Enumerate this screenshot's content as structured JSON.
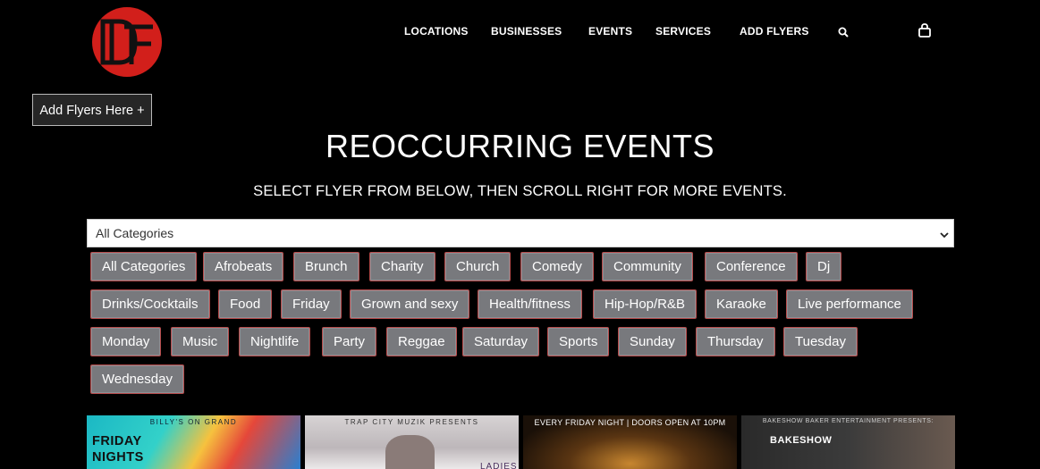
{
  "logo": {
    "text": "DF"
  },
  "nav": {
    "items": [
      {
        "label": "LOCATIONS"
      },
      {
        "label": "BUSINESSES"
      },
      {
        "label": "EVENTS"
      },
      {
        "label": "SERVICES"
      },
      {
        "label": "ADD FLYERS"
      }
    ],
    "search_icon": "search-icon",
    "cart_icon": "bag-icon"
  },
  "add_flyers_button": "Add Flyers Here +",
  "page": {
    "title": "REOCCURRING EVENTS",
    "subtitle": "SELECT FLYER FROM BELOW, THEN SCROLL RIGHT FOR MORE EVENTS."
  },
  "category_select": {
    "value": "All Categories"
  },
  "tags": [
    [
      "All Categories",
      "Afrobeats",
      "Brunch",
      "Charity",
      "Church",
      "Comedy",
      "Community",
      "Conference",
      "Dj"
    ],
    [
      "Drinks/Cocktails",
      "Food",
      "Friday",
      "Grown and sexy",
      "Health/fitness",
      "Hip-Hop/R&B",
      "Karaoke",
      "Live performance"
    ],
    [
      "Monday",
      "Music",
      "Nightlife",
      "Party",
      "Reggae",
      "Saturday",
      "Sports",
      "Sunday",
      "Thursday",
      "Tuesday"
    ],
    [
      "Wednesday"
    ]
  ],
  "flyers": [
    {
      "caption": "BILLY'S ON GRAND",
      "title": "FRIDAY NIGHTS"
    },
    {
      "caption": "TRAP CITY MUZIK PRESENTS",
      "title": "LADIES"
    },
    {
      "caption": "EVERY FRIDAY NIGHT | DOORS OPEN AT 10PM",
      "title": ""
    },
    {
      "caption": "BAKESHOW BAKER ENTERTAINMENT PRESENTS:",
      "title": "BAKESHOW"
    }
  ],
  "colors": {
    "background": "#000000",
    "logo_red": "#d21f1b",
    "tag_bg": "#78797d",
    "tag_border": "#b64b4b"
  }
}
